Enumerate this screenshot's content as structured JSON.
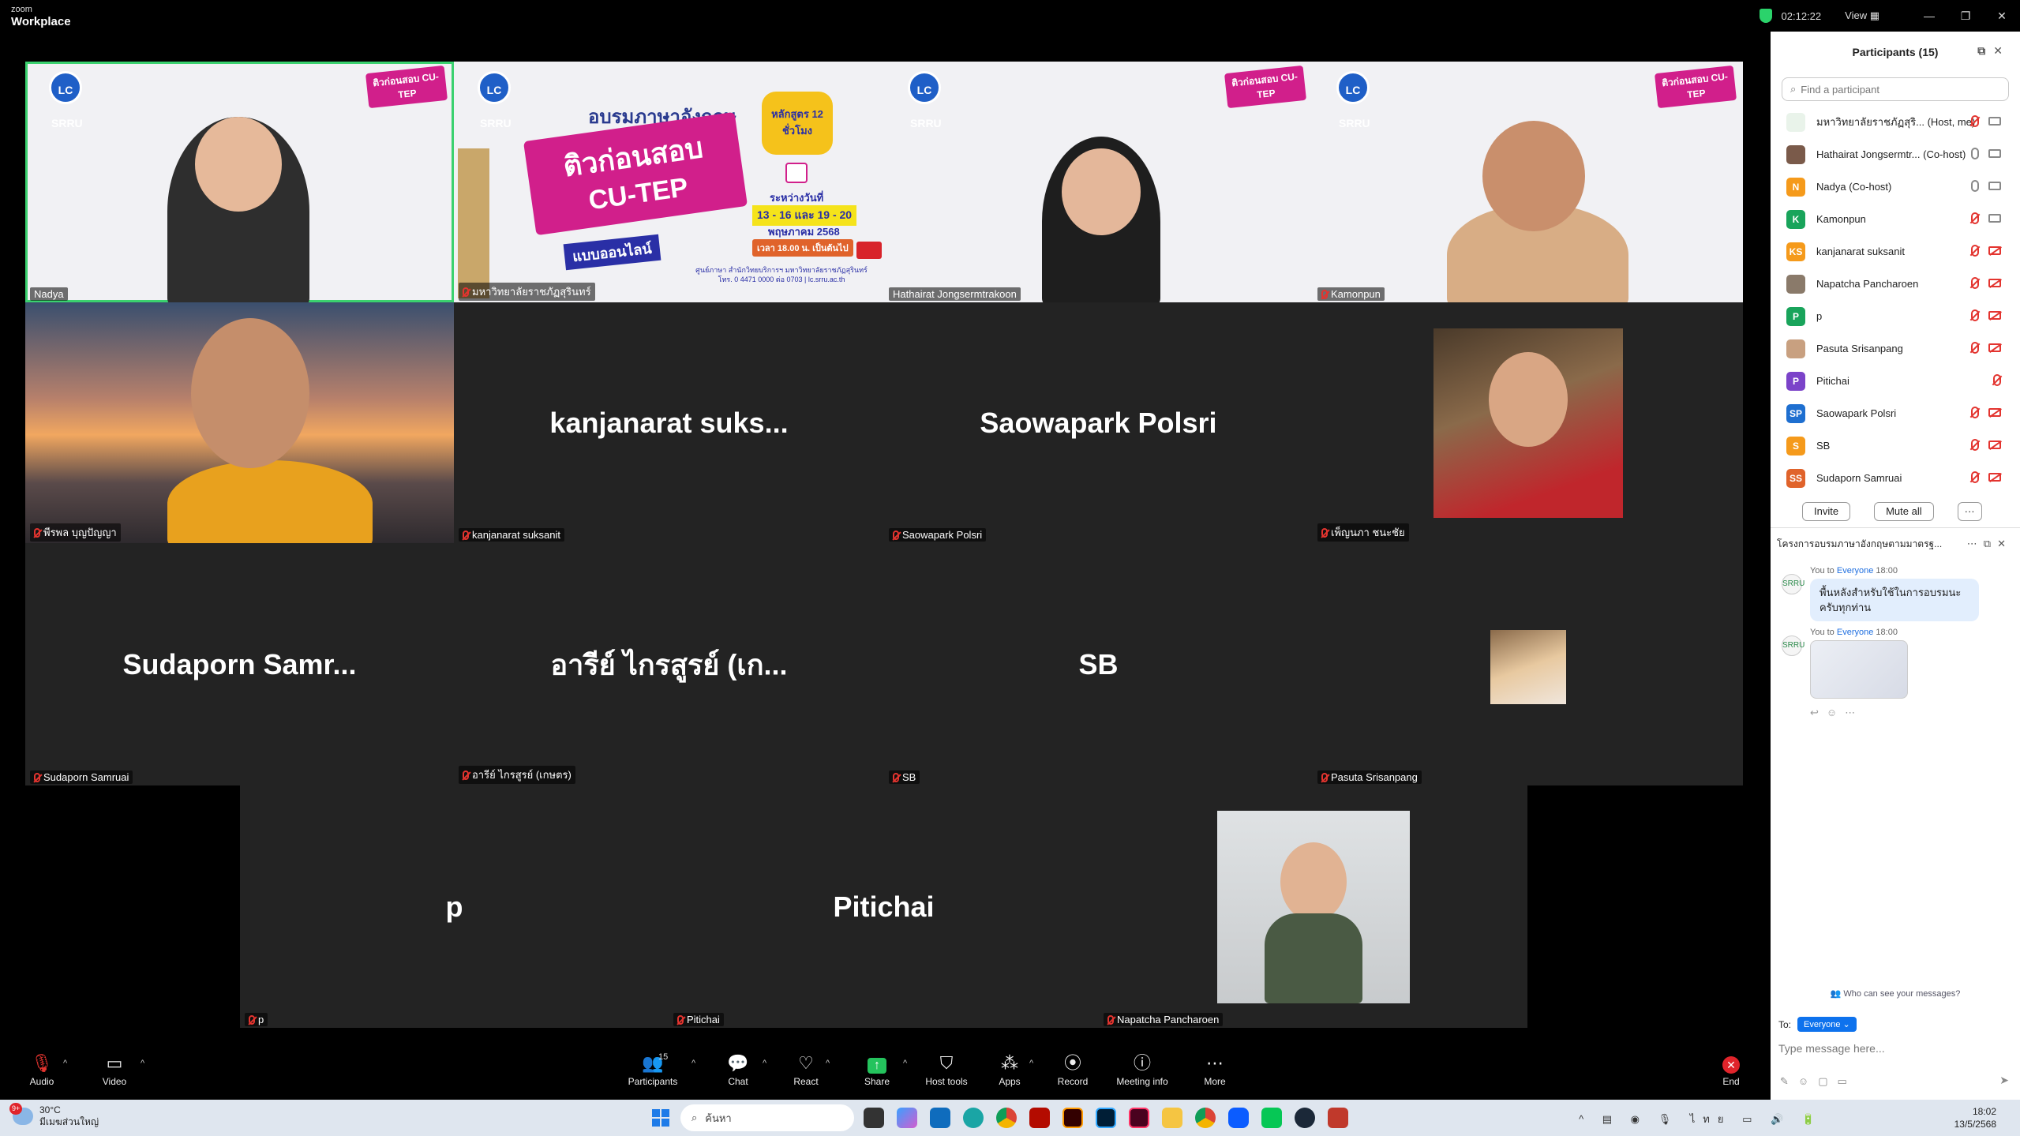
{
  "app": {
    "brand_small": "zoom",
    "brand_big": "Workplace",
    "timer": "02:12:22",
    "view_label": "View"
  },
  "tiles": {
    "t1": {
      "name": "Nadya",
      "logo": "LC SRRU",
      "tag": "ติวก่อนสอบ CU-TEP"
    },
    "t2": {
      "name": "มหาวิทยาลัยราชภัฏสุรินทร์",
      "logo": "LC SRRU",
      "heading": "อบรมภาษาอังกฤษ",
      "title1": "ติวก่อนสอบ",
      "title2": "CU-TEP",
      "subtitle": "แบบออนไลน์",
      "course": "หลักสูตร 12 ชั่วโมง",
      "between": "ระหว่างวันที่",
      "dates": "13 - 16 และ 19 - 20",
      "month": "พฤษภาคม 2568",
      "time": "เวลา 18.00 น. เป็นต้นไป",
      "contact": "ศูนย์ภาษา สำนักวิทยบริการฯ มหาวิทยาลัยราชภัฏสุรินทร์",
      "phone": "โทร. 0 4471 0000 ต่อ 0703 | lc.srru.ac.th"
    },
    "t3": {
      "name": "Hathairat Jongsermtrakoon",
      "logo": "LC SRRU",
      "tag": "ติวก่อนสอบ CU-TEP"
    },
    "t4": {
      "name": "Kamonpun",
      "logo": "LC SRRU",
      "tag": "ติวก่อนสอบ CU-TEP"
    },
    "t5": {
      "name": "พีรพล บุญปัญญา"
    },
    "t6": {
      "name": "kanjanarat suksanit",
      "big": "kanjanarat  suks..."
    },
    "t7": {
      "name": "Saowapark Polsri",
      "big": "Saowapark Polsri"
    },
    "t8": {
      "name": "เพ็ญนภา ชนะชัย"
    },
    "t9": {
      "name": "Sudaporn Samruai",
      "big": "Sudaporn  Samr..."
    },
    "t10": {
      "name": "อารีย์ ไกรสูรย์ (เกษตร)",
      "big": "อารีย์ ไกรสูรย์ (เก..."
    },
    "t11": {
      "name": "SB",
      "big": "SB"
    },
    "t12": {
      "name": "Pasuta Srisanpang"
    },
    "t13": {
      "name": "p",
      "big": "p"
    },
    "t14": {
      "name": "Pitichai",
      "big": "Pitichai"
    },
    "t15": {
      "name": "Napatcha Pancharoen"
    }
  },
  "participants": {
    "title": "Participants (15)",
    "search_placeholder": "Find a participant",
    "list": [
      {
        "name": "มหาวิทยาลัยราชภัฏสุริ...  (Host, me)",
        "initials": "",
        "color": "#e9f3ea"
      },
      {
        "name": "Hathairat Jongsermtr... (Co-host)",
        "initials": "",
        "color": "#7a5a4a"
      },
      {
        "name": "Nadya (Co-host)",
        "initials": "N",
        "color": "#f59a1b"
      },
      {
        "name": "Kamonpun",
        "initials": "K",
        "color": "#19a45b"
      },
      {
        "name": "kanjanarat suksanit",
        "initials": "KS",
        "color": "#f59a1b"
      },
      {
        "name": "Napatcha Pancharoen",
        "initials": "",
        "color": "#8a7a6a"
      },
      {
        "name": "p",
        "initials": "P",
        "color": "#19a45b"
      },
      {
        "name": "Pasuta Srisanpang",
        "initials": "",
        "color": "#c8a080"
      },
      {
        "name": "Pitichai",
        "initials": "P",
        "color": "#7b43c9"
      },
      {
        "name": "Saowapark Polsri",
        "initials": "SP",
        "color": "#1e6fd0"
      },
      {
        "name": "SB",
        "initials": "S",
        "color": "#f59a1b"
      },
      {
        "name": "Sudaporn Samruai",
        "initials": "SS",
        "color": "#e0632b"
      }
    ],
    "invite": "Invite",
    "mute_all": "Mute all",
    "more": "···"
  },
  "chat": {
    "title": "โครงการอบรมภาษาอังกฤษตามมาตรฐ...",
    "avatar": "SRRU",
    "msg1": {
      "you": "You to",
      "to": "Everyone",
      "time": "18:00",
      "text": "พื้นหลังสำหรับใช้ในการอบรมนะครับทุกท่าน"
    },
    "msg2": {
      "you": "You to",
      "to": "Everyone",
      "time": "18:00"
    },
    "who_can": "Who can see your messages?",
    "to_label": "To:",
    "to_value": "Everyone",
    "placeholder": "Type message here..."
  },
  "toolbar": {
    "audio": "Audio",
    "video": "Video",
    "participants": "Participants",
    "participants_count": "15",
    "chat": "Chat",
    "react": "React",
    "share": "Share",
    "host_tools": "Host tools",
    "apps": "Apps",
    "record": "Record",
    "meeting_info": "Meeting info",
    "more": "More",
    "end": "End"
  },
  "taskbar": {
    "temp": "30°C",
    "weather": "มีเมฆส่วนใหญ่",
    "badge": "9+",
    "search": "ค้นหา",
    "lang": "ไทย",
    "time": "18:02",
    "date": "13/5/2568"
  }
}
